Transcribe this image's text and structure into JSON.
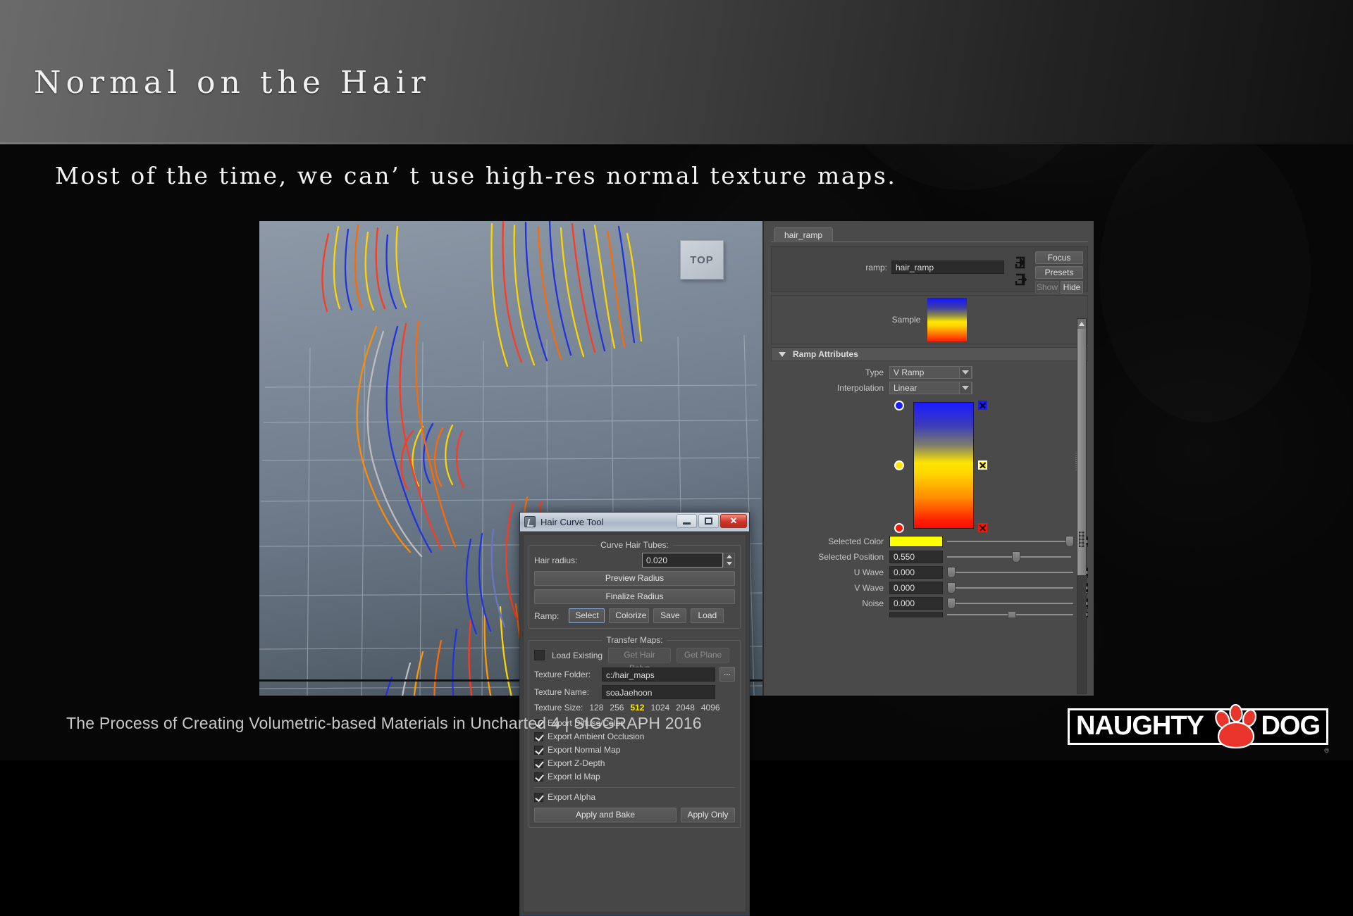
{
  "slide": {
    "title": "Normal on the Hair",
    "body": "Most of the time, we can’ t use high-res normal texture maps.",
    "footer": "The Process of Creating Volumetric-based Materials in Uncharted 4  |  SIGGRAPH 2016",
    "logo": {
      "left_word": "NAUGHTY",
      "right_word": "DOG",
      "registered": "®"
    }
  },
  "viewport": {
    "view_cube_label": "TOP"
  },
  "hair_curve_tool": {
    "title": "Hair Curve Tool",
    "window_buttons": {
      "minimize": "minimize-icon",
      "maximize": "maximize-icon",
      "close": "✕"
    },
    "curve_group": {
      "title": "Curve Hair Tubes:",
      "hair_radius_label": "Hair radius:",
      "hair_radius_value": "0.020",
      "preview_radius": "Preview Radius",
      "finalize_radius": "Finalize Radius",
      "ramp_label": "Ramp:",
      "ramp_buttons": [
        "Select",
        "Colorize",
        "Save",
        "Load"
      ]
    },
    "transfer_group": {
      "title": "Transfer Maps:",
      "load_existing_label": "Load Existing",
      "load_existing_checked": false,
      "get_hair_polys": "Get Hair Polys",
      "get_plane": "Get Plane",
      "texture_folder_label": "Texture Folder:",
      "texture_folder_value": "c:/hair_maps",
      "browse_label": "...",
      "texture_name_label": "Texture Name:",
      "texture_name_value": "soaJaehoon",
      "texture_size_label": "Texture Size:",
      "texture_sizes": [
        "128",
        "256",
        "512",
        "1024",
        "2048",
        "4096"
      ],
      "texture_size_selected": "512",
      "exports": [
        {
          "label": "Export Diffuse/Color",
          "checked": true
        },
        {
          "label": "Export Ambient Occlusion",
          "checked": true
        },
        {
          "label": "Export Normal Map",
          "checked": true
        },
        {
          "label": "Export Z-Depth",
          "checked": true
        },
        {
          "label": "Export Id Map",
          "checked": true
        }
      ],
      "export_alpha": {
        "label": "Export Alpha",
        "checked": true
      },
      "apply_and_bake": "Apply and Bake",
      "apply_only": "Apply Only"
    }
  },
  "attribute_editor": {
    "tab_label": "hair_ramp",
    "ramp_field_label": "ramp:",
    "ramp_field_value": "hair_ramp",
    "buttons": {
      "focus": "Focus",
      "presets": "Presets",
      "show": "Show",
      "hide": "Hide"
    },
    "sample_label": "Sample",
    "section_title": "Ramp Attributes",
    "type_label": "Type",
    "type_value": "V Ramp",
    "interpolation_label": "Interpolation",
    "interpolation_value": "Linear",
    "ramp_markers": [
      {
        "color": "#1b1bff",
        "position": 1.0,
        "name": "blue-marker"
      },
      {
        "color": "#ffe800",
        "position": 0.55,
        "name": "yellow-marker",
        "selected": true
      },
      {
        "color": "#ff1500",
        "position": 0.0,
        "name": "red-marker"
      }
    ],
    "attrs": [
      {
        "label": "Selected Color",
        "value": "",
        "swatch": "#ffff00",
        "slider": 0.97
      },
      {
        "label": "Selected Position",
        "value": "0.550",
        "slider": 0.55
      },
      {
        "label": "U Wave",
        "value": "0.000",
        "slider": 0.0
      },
      {
        "label": "V Wave",
        "value": "0.000",
        "slider": 0.0
      },
      {
        "label": "Noise",
        "value": "0.000",
        "slider": 0.0
      }
    ]
  }
}
